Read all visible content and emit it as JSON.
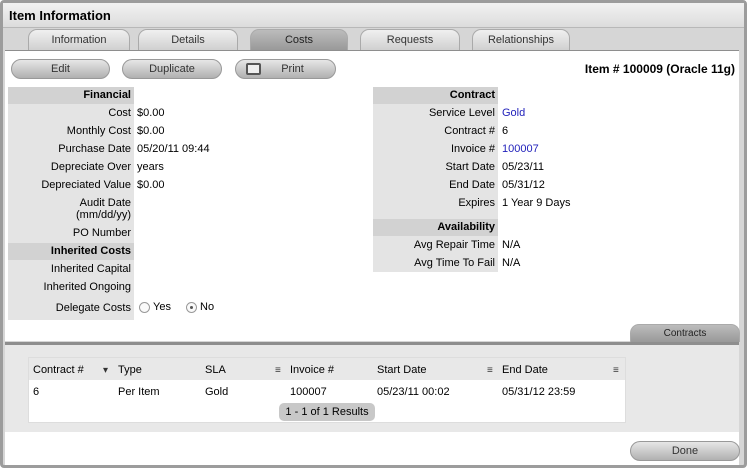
{
  "window": {
    "title": "Item Information"
  },
  "tabs": [
    {
      "label": "Information"
    },
    {
      "label": "Details"
    },
    {
      "label": "Costs"
    },
    {
      "label": "Requests"
    },
    {
      "label": "Relationships"
    }
  ],
  "toolbar": {
    "edit": "Edit",
    "duplicate": "Duplicate",
    "print": "Print",
    "item_title": "Item # 100009 (Oracle 11g)"
  },
  "financial": {
    "header": "Financial",
    "rows": [
      {
        "label": "Cost",
        "value": "$0.00"
      },
      {
        "label": "Monthly Cost",
        "value": "$0.00"
      },
      {
        "label": "Purchase Date",
        "value": "05/20/11 09:44"
      },
      {
        "label": "Depreciate Over",
        "value": "years"
      },
      {
        "label": "Depreciated Value",
        "value": "$0.00"
      },
      {
        "label": "Audit Date",
        "value": ""
      },
      {
        "label": "(mm/dd/yy)",
        "value": ""
      },
      {
        "label": "PO Number",
        "value": ""
      }
    ]
  },
  "inherited": {
    "header": "Inherited Costs",
    "capital_label": "Inherited Capital",
    "ongoing_label": "Inherited Ongoing",
    "delegate_label": "Delegate Costs",
    "yes": "Yes",
    "no": "No",
    "selected": "No"
  },
  "contract": {
    "header": "Contract",
    "rows": [
      {
        "label": "Service Level",
        "value": "Gold"
      },
      {
        "label": "Contract #",
        "value": "6"
      },
      {
        "label": "Invoice #",
        "value": "100007"
      },
      {
        "label": "Start Date",
        "value": "05/23/11"
      },
      {
        "label": "End Date",
        "value": "05/31/12"
      },
      {
        "label": "Expires",
        "value": "1 Year 9 Days"
      }
    ]
  },
  "availability": {
    "header": "Availability",
    "rows": [
      {
        "label": "Avg Repair Time",
        "value": "N/A"
      },
      {
        "label": "Avg Time To Fail",
        "value": "N/A"
      }
    ]
  },
  "contracts_tab": "Contracts",
  "table": {
    "headers": [
      "Contract #",
      "Type",
      "SLA",
      "Invoice #",
      "Start Date",
      "End Date"
    ],
    "rows": [
      [
        "6",
        "Per Item",
        "Gold",
        "100007",
        "05/23/11 00:02",
        "05/31/12 23:59"
      ]
    ],
    "pagination": "1 - 1 of 1 Results"
  },
  "done": "Done"
}
